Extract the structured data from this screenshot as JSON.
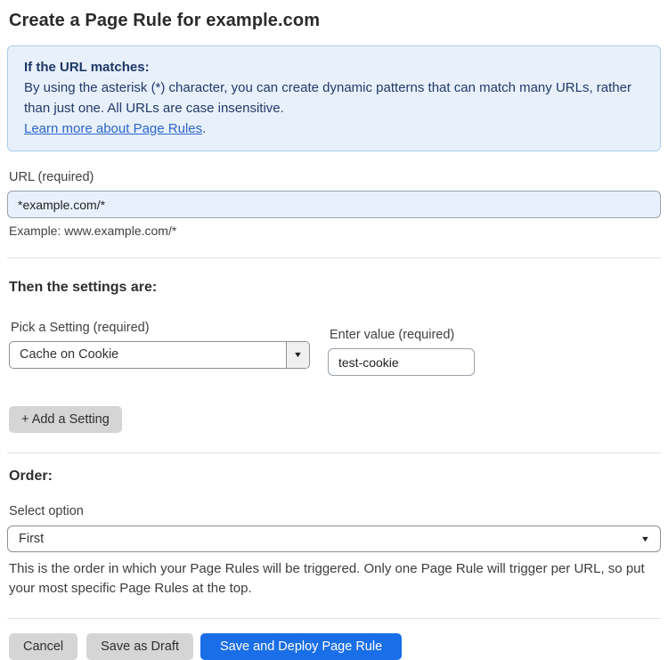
{
  "page": {
    "title": "Create a Page Rule for example.com"
  },
  "info_box": {
    "heading": "If the URL matches:",
    "body": "By using the asterisk (*) character, you can create dynamic patterns that can match many URLs, rather than just one. All URLs are case insensitive.",
    "link_label": "Learn more about Page Rules",
    "link_suffix": "."
  },
  "url_field": {
    "label": "URL (required)",
    "value": "*example.com/*",
    "helper": "Example: www.example.com/*"
  },
  "settings_section": {
    "heading": "Then the settings are:",
    "setting_select": {
      "label": "Pick a Setting (required)",
      "value": "Cache on Cookie"
    },
    "value_input": {
      "label": "Enter value (required)",
      "value": "test-cookie"
    },
    "add_setting_label": "+ Add a Setting"
  },
  "order_section": {
    "heading": "Order:",
    "select_label": "Select option",
    "select_value": "First",
    "helper": "This is the order in which your Page Rules will be triggered. Only one Page Rule will trigger per URL, so put your most specific Page Rules at the top."
  },
  "footer": {
    "cancel_label": "Cancel",
    "save_draft_label": "Save as Draft",
    "save_deploy_label": "Save and Deploy Page Rule"
  },
  "icons": {
    "dropdown_arrow": "▼"
  },
  "colors": {
    "info_box_bg": "#e8f1fb",
    "info_box_border": "#aacbee",
    "info_text": "#21386b",
    "link": "#2d65cc",
    "url_input_bg": "#e8f0fe",
    "primary_button_bg": "#1a6ee8",
    "gray_button_bg": "#d5d5d5"
  }
}
